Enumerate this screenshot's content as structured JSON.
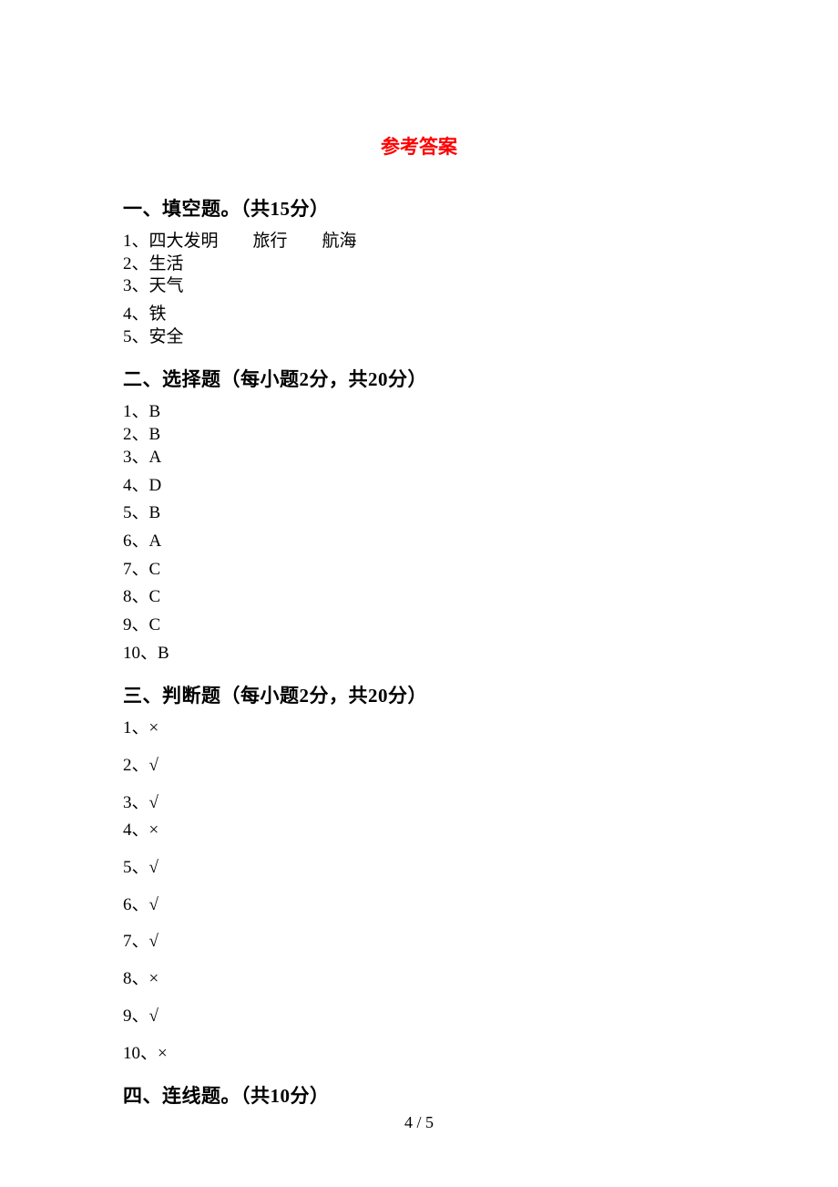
{
  "title": "参考答案",
  "sections": {
    "s1": {
      "heading": "一、填空题。（共15分）",
      "answers": [
        "1、四大发明　　旅行　　航海",
        "2、生活",
        "3、天气",
        "4、铁",
        "5、安全"
      ]
    },
    "s2": {
      "heading": "二、选择题（每小题2分，共20分）",
      "answers": [
        "1、B",
        "2、B",
        "3、A",
        "4、D",
        "5、B",
        "6、A",
        "7、C",
        "8、C",
        "9、C",
        "10、B"
      ]
    },
    "s3": {
      "heading": "三、判断题（每小题2分，共20分）",
      "answers": [
        "1、×",
        "2、√",
        "3、√",
        "4、×",
        "5、√",
        "6、√",
        "7、√",
        "8、×",
        "9、√",
        "10、×"
      ]
    },
    "s4": {
      "heading": "四、连线题。（共10分）"
    }
  },
  "pageNumber": "4 / 5"
}
